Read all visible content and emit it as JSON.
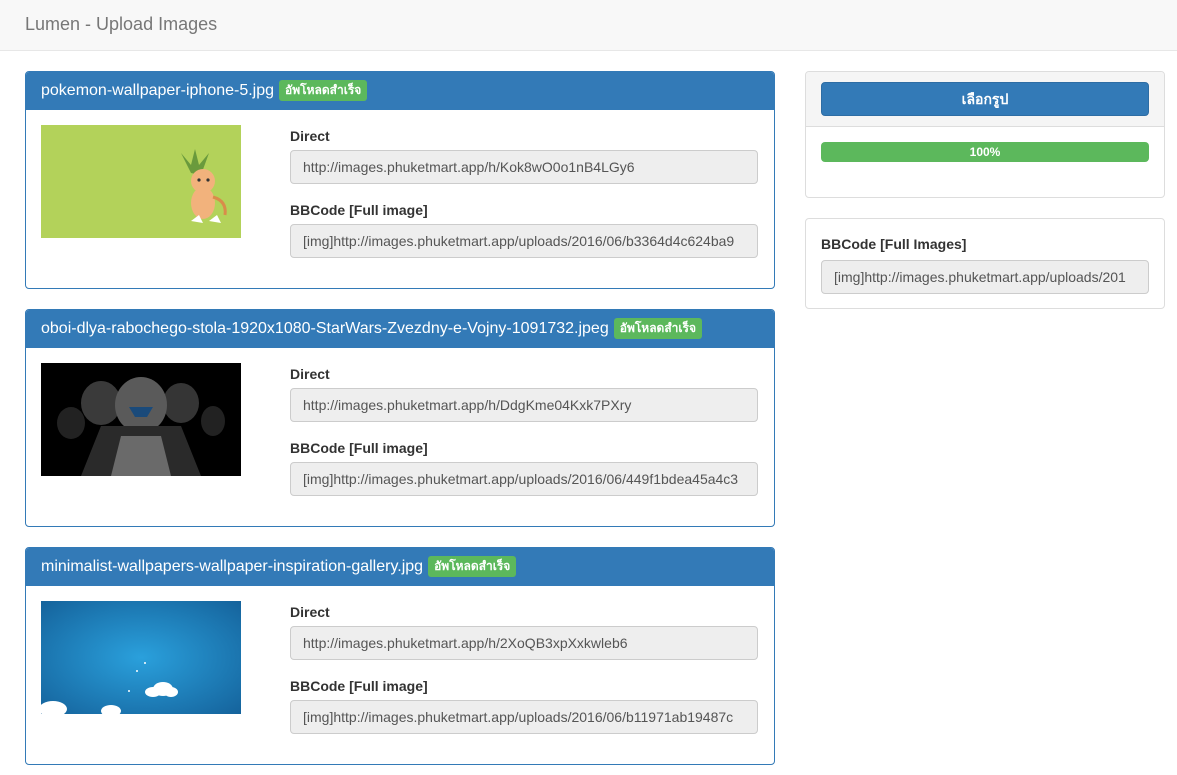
{
  "app": {
    "title": "Lumen - Upload Images"
  },
  "uploads": [
    {
      "filename": "pokemon-wallpaper-iphone-5.jpg",
      "status": "อัพโหลดสำเร็จ",
      "direct_label": "Direct",
      "direct_url": "http://images.phuketmart.app/h/Kok8wO0o1nB4LGy6",
      "bbcode_label": "BBCode [Full image]",
      "bbcode": "[img]http://images.phuketmart.app/uploads/2016/06/b3364d4c624ba9"
    },
    {
      "filename": "oboi-dlya-rabochego-stola-1920x1080-StarWars-Zvezdny-e-Vojny-1091732.jpeg",
      "status": "อัพโหลดสำเร็จ",
      "direct_label": "Direct",
      "direct_url": "http://images.phuketmart.app/h/DdgKme04Kxk7PXry",
      "bbcode_label": "BBCode [Full image]",
      "bbcode": "[img]http://images.phuketmart.app/uploads/2016/06/449f1bdea45a4c3"
    },
    {
      "filename": "minimalist-wallpapers-wallpaper-inspiration-gallery.jpg",
      "status": "อัพโหลดสำเร็จ",
      "direct_label": "Direct",
      "direct_url": "http://images.phuketmart.app/h/2XoQB3xpXxkwleb6",
      "bbcode_label": "BBCode [Full image]",
      "bbcode": "[img]http://images.phuketmart.app/uploads/2016/06/b11971ab19487c"
    }
  ],
  "sidebar": {
    "choose_button": "เลือกรูป",
    "progress_value": 100,
    "progress_label": "100%",
    "bbcode_all_label": "BBCode [Full Images]",
    "bbcode_all": "[img]http://images.phuketmart.app/uploads/201"
  },
  "colors": {
    "primary": "#337ab7",
    "success": "#5cb85c",
    "navbar": "#f8f8f8"
  }
}
